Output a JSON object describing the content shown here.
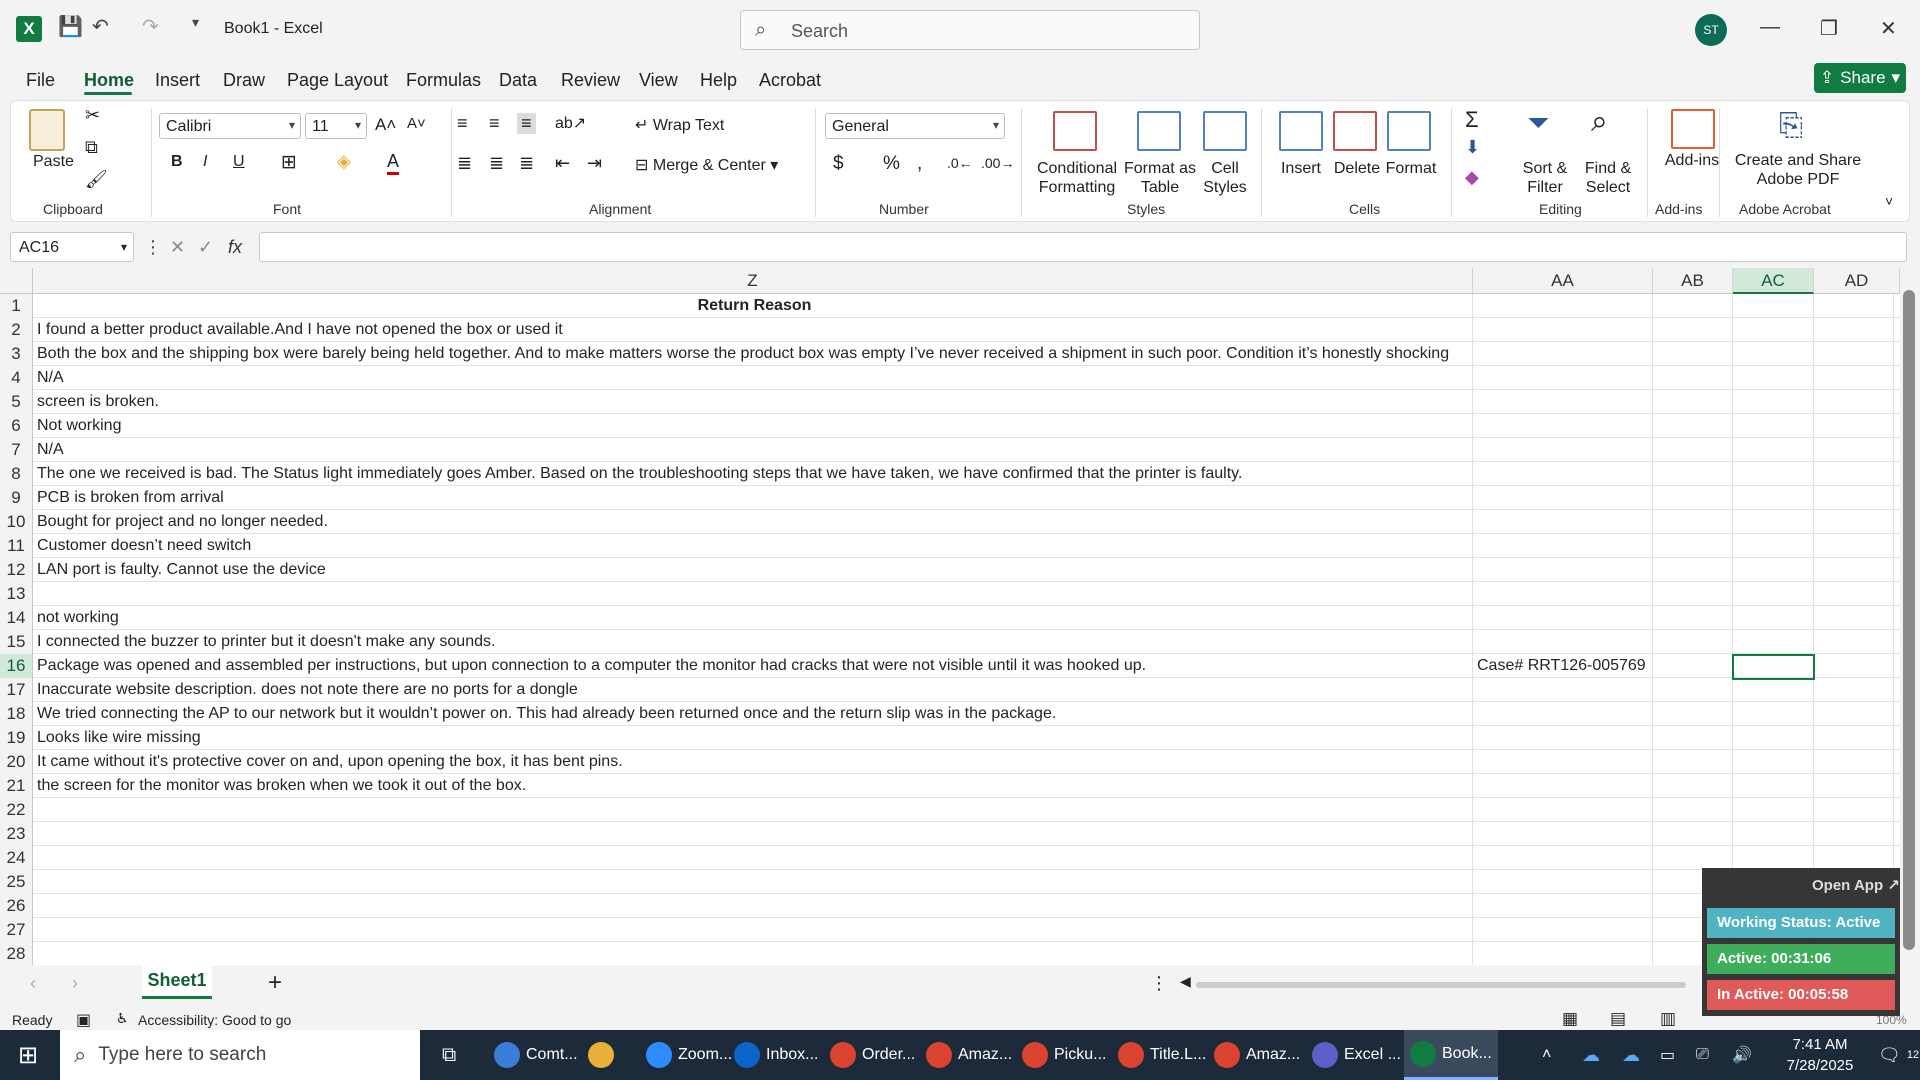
{
  "window": {
    "title": "Book1  -  Excel",
    "search_placeholder": "Search",
    "avatar_initials": "ST"
  },
  "menu": {
    "items": [
      "File",
      "Home",
      "Insert",
      "Draw",
      "Page Layout",
      "Formulas",
      "Data",
      "Review",
      "View",
      "Help",
      "Acrobat"
    ],
    "active": "Home",
    "share_label": "Share"
  },
  "ribbon": {
    "clipboard": {
      "paste": "Paste",
      "label": "Clipboard"
    },
    "font": {
      "name": "Calibri",
      "size": "11",
      "label": "Font"
    },
    "alignment": {
      "wrap_text": "Wrap Text",
      "merge_center": "Merge & Center",
      "label": "Alignment"
    },
    "number": {
      "format": "General",
      "label": "Number"
    },
    "styles": {
      "conditional": "Conditional\nFormatting",
      "format_table": "Format as\nTable",
      "cell_styles": "Cell\nStyles",
      "label": "Styles"
    },
    "cells": {
      "insert": "Insert",
      "delete": "Delete",
      "format": "Format",
      "label": "Cells"
    },
    "editing": {
      "sort_filter": "Sort &\nFilter",
      "find_select": "Find &\nSelect",
      "label": "Editing"
    },
    "addins": {
      "addins": "Add-ins",
      "label": "Add-ins"
    },
    "acrobat": {
      "create_share": "Create and Share\nAdobe PDF",
      "label": "Adobe Acrobat"
    }
  },
  "formula_bar": {
    "name_box": "AC16",
    "formula": ""
  },
  "columns": [
    "Z",
    "AA",
    "AB",
    "AC",
    "AD"
  ],
  "selected_column": "AC",
  "selected_row": 16,
  "rows": [
    {
      "n": "1",
      "z": "Return Reason",
      "aa": ""
    },
    {
      "n": "2",
      "z": "I found a better product available.And I have not opened the box or used it",
      "aa": ""
    },
    {
      "n": "3",
      "z": "Both the box and the shipping box were barely being held together. And to make matters worse the product box was empty I’ve never received a shipment in such poor. Condition it’s honestly shocking",
      "aa": ""
    },
    {
      "n": "4",
      "z": "N/A",
      "aa": ""
    },
    {
      "n": "5",
      "z": "screen is broken.",
      "aa": ""
    },
    {
      "n": "6",
      "z": "Not working",
      "aa": ""
    },
    {
      "n": "7",
      "z": "N/A",
      "aa": ""
    },
    {
      "n": "8",
      "z": "The one we received is bad. The Status light immediately goes Amber. Based on the troubleshooting steps that we have taken, we have confirmed that the printer is faulty.",
      "aa": ""
    },
    {
      "n": "9",
      "z": "PCB is broken from arrival",
      "aa": ""
    },
    {
      "n": "10",
      "z": "Bought for project and no longer needed.",
      "aa": ""
    },
    {
      "n": "11",
      "z": "Customer doesn’t need switch",
      "aa": ""
    },
    {
      "n": "12",
      "z": "LAN port is faulty. Cannot use the device",
      "aa": ""
    },
    {
      "n": "13",
      "z": "",
      "aa": ""
    },
    {
      "n": "14",
      "z": "not working",
      "aa": ""
    },
    {
      "n": "15",
      "z": "I connected the buzzer to printer but it doesn't make any sounds.",
      "aa": ""
    },
    {
      "n": "16",
      "z": "Package was opened and assembled per instructions, but upon connection to a computer the monitor had cracks that were not visible until it was hooked up.",
      "aa": "Case# RRT126-005769"
    },
    {
      "n": "17",
      "z": "Inaccurate website description. does not note there are no ports for a dongle",
      "aa": ""
    },
    {
      "n": "18",
      "z": "We tried connecting the AP to our network but it wouldn’t power on. This had already been returned once and the return slip was in the package.",
      "aa": ""
    },
    {
      "n": "19",
      "z": "Looks like wire missing",
      "aa": ""
    },
    {
      "n": "20",
      "z": "It came without it's protective cover on and, upon opening the box, it has bent pins.",
      "aa": ""
    },
    {
      "n": "21",
      "z": "the screen for the monitor was broken when we took it out of the box.",
      "aa": ""
    },
    {
      "n": "22",
      "z": "",
      "aa": ""
    },
    {
      "n": "23",
      "z": "",
      "aa": ""
    },
    {
      "n": "24",
      "z": "",
      "aa": ""
    },
    {
      "n": "25",
      "z": "",
      "aa": ""
    },
    {
      "n": "26",
      "z": "",
      "aa": ""
    },
    {
      "n": "27",
      "z": "",
      "aa": ""
    },
    {
      "n": "28",
      "z": "",
      "aa": ""
    }
  ],
  "sheets": {
    "active": "Sheet1"
  },
  "status": {
    "ready": "Ready",
    "accessibility": "Accessibility: Good to go",
    "zoom": "100%"
  },
  "widget": {
    "open_app": "Open App ↗",
    "working_status": "Working Status: Active",
    "active": "Active: 00:31:06",
    "inactive": "In Active: 00:05:58",
    "colors": {
      "working": "#4fb3c2",
      "active": "#3fae5a",
      "inactive": "#e05a5a"
    }
  },
  "taskbar": {
    "search_placeholder": "Type here to search",
    "items": [
      {
        "label": "Comt...",
        "color": "#3b7dd8"
      },
      {
        "label": "",
        "color": "#e8b23a"
      },
      {
        "label": "Zoom...",
        "color": "#2d8cff"
      },
      {
        "label": "Inbox...",
        "color": "#0a64c9"
      },
      {
        "label": "Order...",
        "color": "#d9432f"
      },
      {
        "label": "Amaz...",
        "color": "#d9432f"
      },
      {
        "label": "Picku...",
        "color": "#d9432f"
      },
      {
        "label": "Title.L...",
        "color": "#d9432f"
      },
      {
        "label": "Amaz...",
        "color": "#d9432f"
      },
      {
        "label": "Excel ...",
        "color": "#5b5fc7"
      },
      {
        "label": "Book...",
        "color": "#107c41"
      }
    ],
    "time": "7:41 AM",
    "date": "7/28/2025",
    "notifications": "12"
  }
}
